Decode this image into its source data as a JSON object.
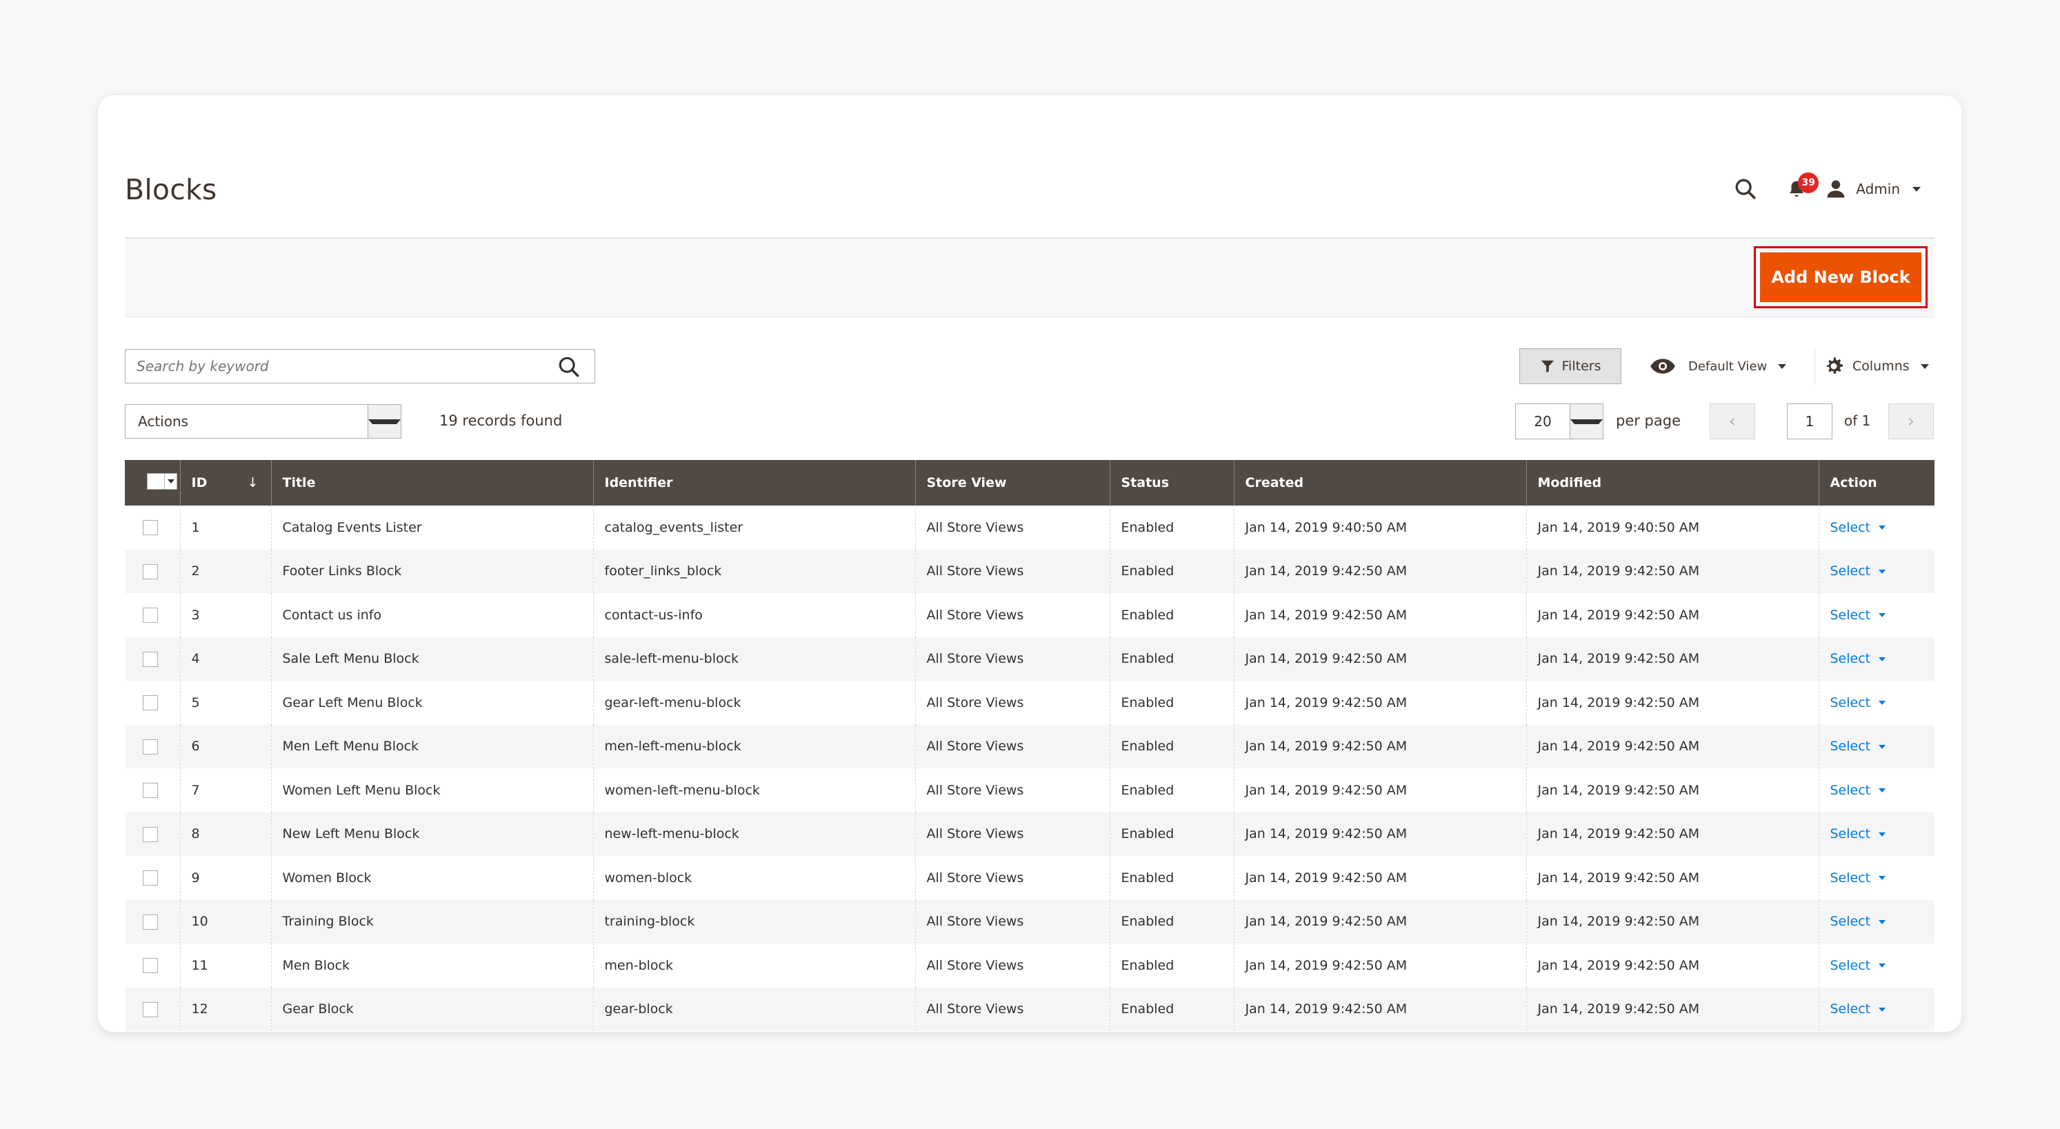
{
  "page": {
    "title": "Blocks"
  },
  "header": {
    "notification_count": "39",
    "user_name": "Admin"
  },
  "toolbar": {
    "add_button": "Add New Block",
    "search_placeholder": "Search by keyword",
    "filters_label": "Filters",
    "view_label": "Default View",
    "columns_label": "Columns",
    "actions_label": "Actions",
    "records_found": "19 records found",
    "per_page_value": "20",
    "per_page_label": "per page",
    "page_value": "1",
    "page_of": "of 1"
  },
  "icons": {
    "search": "search-icon",
    "bell": "bell-icon",
    "user": "user-icon",
    "filter": "filter-icon",
    "eye": "eye-icon",
    "gear": "gear-icon",
    "prev": "chevron-left-icon",
    "next": "chevron-right-icon"
  },
  "colors": {
    "accent": "#eb5202",
    "highlight_border": "#d20000",
    "header_bg": "#514943",
    "link": "#007bdb",
    "badge": "#e22626"
  },
  "table": {
    "columns": [
      "ID",
      "Title",
      "Identifier",
      "Store View",
      "Status",
      "Created",
      "Modified",
      "Action"
    ],
    "sort_indicator": "↓",
    "rows": [
      {
        "id": "1",
        "title": "Catalog Events Lister",
        "identifier": "catalog_events_lister",
        "store": "All Store Views",
        "status": "Enabled",
        "created": "Jan 14, 2019 9:40:50 AM",
        "modified": "Jan 14, 2019 9:40:50 AM",
        "action": "Select"
      },
      {
        "id": "2",
        "title": "Footer Links Block",
        "identifier": "footer_links_block",
        "store": "All Store Views",
        "status": "Enabled",
        "created": "Jan 14, 2019 9:42:50 AM",
        "modified": "Jan 14, 2019 9:42:50 AM",
        "action": "Select"
      },
      {
        "id": "3",
        "title": "Contact us info",
        "identifier": "contact-us-info",
        "store": "All Store Views",
        "status": "Enabled",
        "created": "Jan 14, 2019 9:42:50 AM",
        "modified": "Jan 14, 2019 9:42:50 AM",
        "action": "Select"
      },
      {
        "id": "4",
        "title": "Sale Left Menu Block",
        "identifier": "sale-left-menu-block",
        "store": "All Store Views",
        "status": "Enabled",
        "created": "Jan 14, 2019 9:42:50 AM",
        "modified": "Jan 14, 2019 9:42:50 AM",
        "action": "Select"
      },
      {
        "id": "5",
        "title": "Gear Left Menu Block",
        "identifier": "gear-left-menu-block",
        "store": "All Store Views",
        "status": "Enabled",
        "created": "Jan 14, 2019 9:42:50 AM",
        "modified": "Jan 14, 2019 9:42:50 AM",
        "action": "Select"
      },
      {
        "id": "6",
        "title": "Men Left Menu Block",
        "identifier": "men-left-menu-block",
        "store": "All Store Views",
        "status": "Enabled",
        "created": "Jan 14, 2019 9:42:50 AM",
        "modified": "Jan 14, 2019 9:42:50 AM",
        "action": "Select"
      },
      {
        "id": "7",
        "title": "Women Left Menu Block",
        "identifier": "women-left-menu-block",
        "store": "All Store Views",
        "status": "Enabled",
        "created": "Jan 14, 2019 9:42:50 AM",
        "modified": "Jan 14, 2019 9:42:50 AM",
        "action": "Select"
      },
      {
        "id": "8",
        "title": "New Left Menu Block",
        "identifier": "new-left-menu-block",
        "store": "All Store Views",
        "status": "Enabled",
        "created": "Jan 14, 2019 9:42:50 AM",
        "modified": "Jan 14, 2019 9:42:50 AM",
        "action": "Select"
      },
      {
        "id": "9",
        "title": "Women Block",
        "identifier": "women-block",
        "store": "All Store Views",
        "status": "Enabled",
        "created": "Jan 14, 2019 9:42:50 AM",
        "modified": "Jan 14, 2019 9:42:50 AM",
        "action": "Select"
      },
      {
        "id": "10",
        "title": "Training Block",
        "identifier": "training-block",
        "store": "All Store Views",
        "status": "Enabled",
        "created": "Jan 14, 2019 9:42:50 AM",
        "modified": "Jan 14, 2019 9:42:50 AM",
        "action": "Select"
      },
      {
        "id": "11",
        "title": "Men Block",
        "identifier": "men-block",
        "store": "All Store Views",
        "status": "Enabled",
        "created": "Jan 14, 2019 9:42:50 AM",
        "modified": "Jan 14, 2019 9:42:50 AM",
        "action": "Select"
      },
      {
        "id": "12",
        "title": "Gear Block",
        "identifier": "gear-block",
        "store": "All Store Views",
        "status": "Enabled",
        "created": "Jan 14, 2019 9:42:50 AM",
        "modified": "Jan 14, 2019 9:42:50 AM",
        "action": "Select"
      }
    ]
  }
}
